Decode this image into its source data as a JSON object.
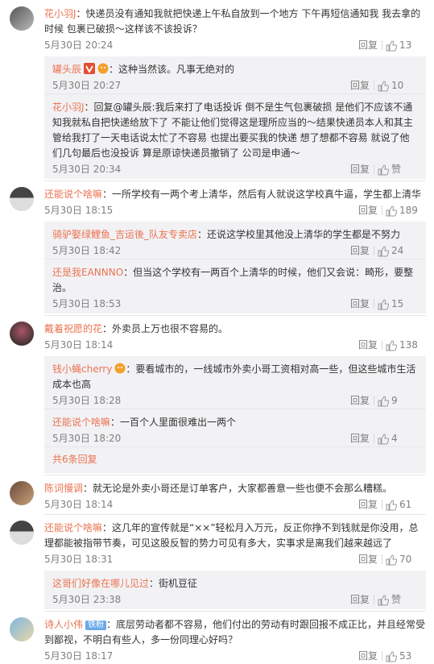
{
  "colors": {
    "accent": "#eb7350",
    "meta": "#808080",
    "subBg": "#f2f2f5"
  },
  "reply_label": "回复",
  "icons": {
    "like": "thumbs-up-icon",
    "verified": "verified-badge-icon",
    "member": "member-badge-icon"
  },
  "comments": [
    {
      "user": "花小羽J",
      "text": "：快递员没有通知我就把快递上午私自放到一个地方 下午再短信通知我 我去拿的时候 包裹已破损～这样该不该投诉？",
      "time": "5月30日 20:24",
      "likes": "13",
      "replies": [
        {
          "user": "罐头辰",
          "text": "：这种当然该。凡事无绝对的",
          "time": "5月30日 20:27",
          "likes": "10"
        },
        {
          "user": "花小羽J",
          "text": "：回复@罐头辰:我后来打了电话投诉 倒不是生气包裹破损 是他们不应该不通知我就私自把快递给放下了 不能让他们觉得这是理所应当的～结果快递员本人和其主管给我打了一天电话说太忙了不容易 也提出要买我的快递 想了想都不容易 就说了他们几句最后也没投诉 算是原谅快递员撤销了 公司是申通～",
          "time": "5月30日 20:34",
          "likes": "赞"
        }
      ]
    },
    {
      "user": "还能说个啥嘛",
      "text": "：一所学校有一两个考上清华，然后有人就说这学校真牛逼，学生都上清华",
      "time": "5月30日 18:15",
      "likes": "189",
      "replies": [
        {
          "user": "骑驴娶绿鲤鱼_吉运後_队友专卖店",
          "text": "：还说这学校里其他没上清华的学生都是不努力",
          "time": "5月30日 18:42",
          "likes": "24"
        },
        {
          "user": "还是我EANNNO",
          "text": "：但当这个学校有一两百个上清华的时候，他们又会说：畸形，要整治。",
          "time": "5月30日 18:53",
          "likes": "15"
        }
      ]
    },
    {
      "user": "戴着祝愿的花",
      "text": "：外卖员上万也很不容易的。",
      "time": "5月30日 18:14",
      "likes": "138",
      "replies": [
        {
          "user": "钱小蝇cherry",
          "text": "：要看城市的，一线城市外卖小哥工资相对高一些，但这些城市生活成本也高",
          "time": "5月30日 18:28",
          "likes": "9"
        },
        {
          "user": "还能说个啥嘛",
          "text": "：一百个人里面很难出一两个",
          "time": "5月30日 18:20",
          "likes": "4"
        }
      ],
      "more": "共6条回复"
    },
    {
      "user": "陈词慢调",
      "text": "：就无论是外卖小哥还是订单客户，大家都善意一些也便不会那么糟糕。",
      "time": "5月30日 18:14",
      "likes": "61",
      "replies": []
    },
    {
      "user": "还能说个啥嘛",
      "text": "：这几年的宣传就是“××”轻松月入万元，反正你挣不到钱就是你没用，总理都能被指带节奏，可见这股反智的势力可见有多大，实事求是离我们越来越远了",
      "time": "5月30日 18:31",
      "likes": "70",
      "replies": [
        {
          "user": "这哥们好像在哪儿见过",
          "text": "：街机豆征",
          "time": "5月30日 23:38",
          "likes": "赞"
        }
      ]
    },
    {
      "user": "诗人小伟",
      "text": "：底层劳动者都不容易，他们付出的劳动有时跟回报不成正比，并且经常受到鄙视，不明白有些人，多一份同理心好吗？",
      "time": "5月30日 18:17",
      "likes": "53",
      "replies": []
    }
  ]
}
